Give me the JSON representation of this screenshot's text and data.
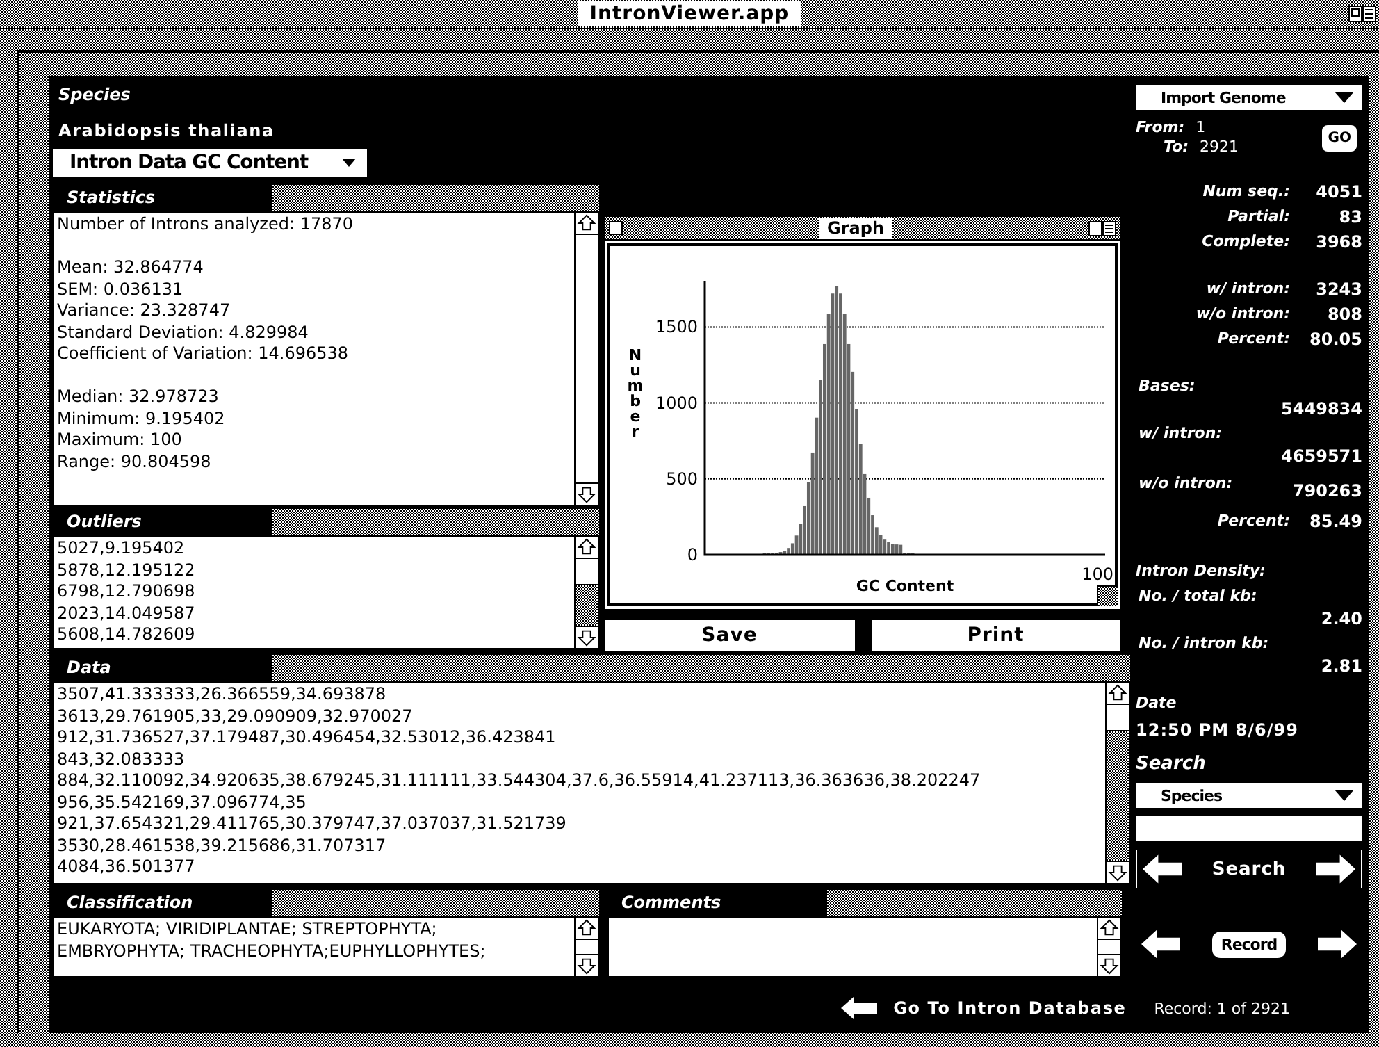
{
  "window": {
    "title": "IntronViewer.app"
  },
  "species": {
    "label": "Species",
    "name": "Arabidopsis thaliana"
  },
  "dataset_dropdown": {
    "value": "Intron Data GC Content"
  },
  "statistics": {
    "heading": "Statistics",
    "paragraphs": [
      [
        "Number of Introns analyzed: 17870"
      ],
      [
        "Mean: 32.864774",
        "SEM: 0.036131",
        "Variance: 23.328747",
        "Standard Deviation: 4.829984",
        "Coefficient of Variation: 14.696538"
      ],
      [
        "Median: 32.978723",
        "Minimum: 9.195402",
        "Maximum: 100",
        "Range: 90.804598"
      ]
    ]
  },
  "outliers": {
    "heading": "Outliers",
    "rows": [
      "5027,9.195402",
      "5878,12.195122",
      "6798,12.790698",
      "2023,14.049587",
      "5608,14.782609"
    ]
  },
  "graph": {
    "title": "Graph",
    "y_axis_title": "Number",
    "x_axis_title": "GC Content",
    "y_ticks": [
      "1500",
      "1000",
      "500",
      "0"
    ],
    "x_end_label": "100"
  },
  "buttons": [
    "Save",
    "Print"
  ],
  "data": {
    "heading": "Data",
    "rows": [
      "3507,41.333333,26.366559,34.693878",
      "3613,29.761905,33,29.090909,32.970027",
      "912,31.736527,37.179487,30.496454,32.53012,36.423841",
      "843,32.083333",
      "884,32.110092,34.920635,38.679245,31.111111,33.544304,37.6,36.55914,41.237113,36.363636,38.202247",
      "956,35.542169,37.096774,35",
      "921,37.654321,29.411765,30.379747,37.037037,31.521739",
      "3530,28.461538,39.215686,31.707317",
      "4084,36.501377"
    ]
  },
  "classification": {
    "heading": "Classification",
    "lines": [
      "EUKARYOTA; VIRIDIPLANTAE; STREPTOPHYTA;",
      "EMBRYOPHYTA; TRACHEOPHYTA;EUPHYLLOPHYTES;"
    ]
  },
  "comments": {
    "heading": "Comments"
  },
  "sidebar": {
    "import_dropdown": "Import Genome",
    "from_label": "From:",
    "from_value": "1",
    "to_label": "To:",
    "to_value": "2921",
    "go_button": "GO",
    "stat_groups": [
      [
        {
          "kind": "inline",
          "label": "Num seq.:",
          "value": "4051"
        },
        {
          "kind": "inline",
          "label": "Partial:",
          "value": "83"
        },
        {
          "kind": "inline",
          "label": "Complete:",
          "value": "3968"
        }
      ],
      [
        {
          "kind": "inline",
          "label": "w/ intron:",
          "value": "3243"
        },
        {
          "kind": "inline",
          "label": "w/o intron:",
          "value": "808"
        },
        {
          "kind": "inline",
          "label": "Percent:",
          "value": "80.05"
        }
      ],
      [
        {
          "kind": "below",
          "label": "Bases:",
          "value": "5449834"
        },
        {
          "kind": "below",
          "label": "w/ intron:",
          "value": "4659571"
        },
        {
          "kind": "offset",
          "label": "w/o intron:",
          "value": "790263"
        },
        {
          "kind": "inline",
          "label": "Percent:",
          "value": "85.49"
        }
      ],
      [
        {
          "kind": "heading",
          "label": "Intron Density:"
        },
        {
          "kind": "below",
          "label": "No. / total kb:",
          "value": "2.40"
        },
        {
          "kind": "below",
          "label": "No. / intron kb:",
          "value": "2.81"
        }
      ]
    ],
    "date_label": "Date",
    "date": "12:50 PM 8/6/99",
    "search_label": "Search",
    "search_dropdown": "Species",
    "search_button": "Search",
    "record_button": "Record"
  },
  "footer": {
    "link": "Go To Intron Database",
    "record": "Record: 1 of 2921"
  }
}
